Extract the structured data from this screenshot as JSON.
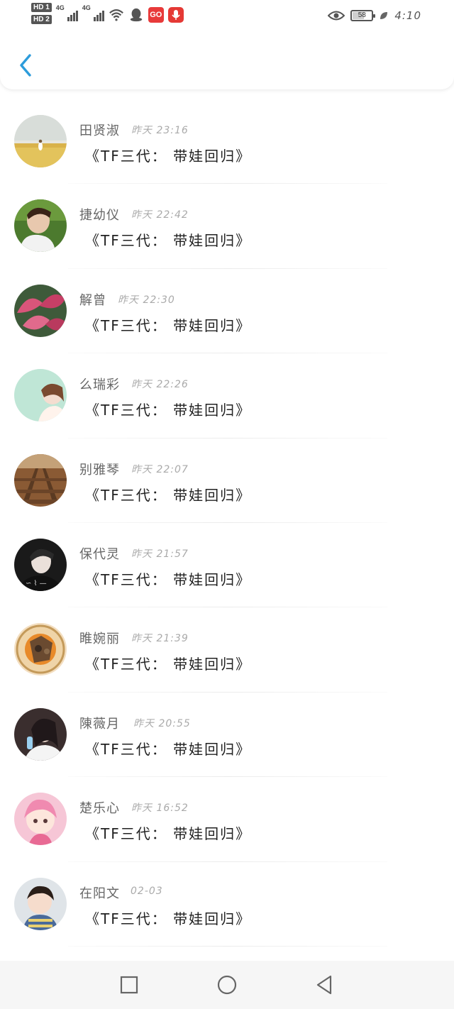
{
  "status_bar": {
    "sim1": "HD 1",
    "sim2": "HD 2",
    "net1": "4G",
    "net2": "4G",
    "app_icon_text": "GO",
    "battery": "58",
    "time": "4:10"
  },
  "header": {
    "back_icon": "chevron-left-icon",
    "accent": "#2d9cdb"
  },
  "messages": [
    {
      "name": "田贤淑",
      "time": "昨天 23:16",
      "text": "《TF三代： 带娃回归》",
      "avatar": "field-girl"
    },
    {
      "name": "捷幼仪",
      "time": "昨天 22:42",
      "text": "《TF三代： 带娃回归》",
      "avatar": "boy-portrait"
    },
    {
      "name": "解曾",
      "time": "昨天 22:30",
      "text": "《TF三代： 带娃回归》",
      "avatar": "pink-leaves"
    },
    {
      "name": "么瑞彩",
      "time": "昨天 22:26",
      "text": "《TF三代： 带娃回归》",
      "avatar": "illustrated-girl"
    },
    {
      "name": "别雅琴",
      "time": "昨天 22:07",
      "text": "《TF三代： 带娃回归》",
      "avatar": "railway-tracks"
    },
    {
      "name": "保代灵",
      "time": "昨天 21:57",
      "text": "《TF三代： 带娃回归》",
      "avatar": "dark-portrait"
    },
    {
      "name": "睢婉丽",
      "time": "昨天 21:39",
      "text": "《TF三代： 带娃回归》",
      "avatar": "cartoon-badge"
    },
    {
      "name": "陳薇月",
      "time": "昨天 20:55",
      "text": "《TF三代： 带娃回归》",
      "avatar": "girl-with-bottle"
    },
    {
      "name": "楚乐心",
      "time": "昨天 16:52",
      "text": "《TF三代： 带娃回归》",
      "avatar": "pink-anime"
    },
    {
      "name": "在阳文",
      "time": "02-03",
      "text": "《TF三代： 带娃回归》",
      "avatar": "toddler"
    }
  ],
  "nav_bar": {
    "recents_icon": "square-icon",
    "home_icon": "circle-icon",
    "back_icon": "triangle-back-icon"
  }
}
